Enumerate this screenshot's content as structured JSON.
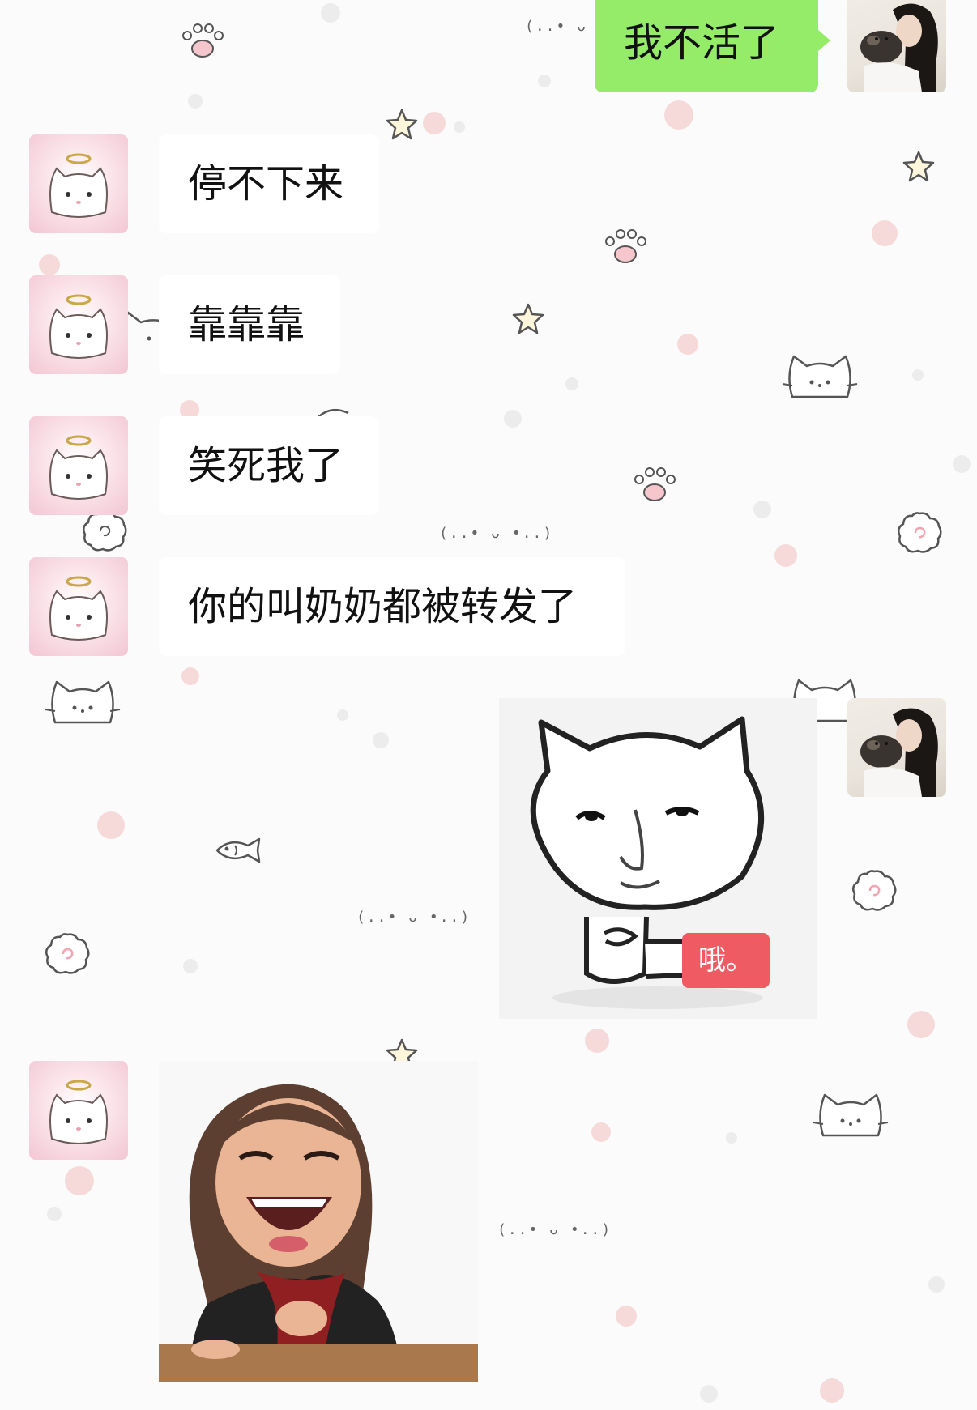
{
  "chat": {
    "messages": [
      {
        "sender": "me",
        "text": "我不活了"
      },
      {
        "sender": "friend",
        "text": "停不下来"
      },
      {
        "sender": "friend",
        "text": "靠靠靠"
      },
      {
        "sender": "friend",
        "text": "笑死我了"
      },
      {
        "sender": "friend",
        "text": "你的叫奶奶都被转发了"
      },
      {
        "sender": "me",
        "type": "sticker",
        "sticker": "cat-meme-sticker",
        "caption": "哦。"
      },
      {
        "sender": "friend",
        "type": "sticker",
        "sticker": "laughing-woman-sticker"
      }
    ]
  },
  "wallpaper": {
    "kaomoji": "(..• ᴗ •..)"
  },
  "colors": {
    "my_bubble": "#95ec69",
    "friend_bubble": "#ffffff",
    "sticker_tag": "#ef5b62",
    "background": "#fbfbfb"
  }
}
